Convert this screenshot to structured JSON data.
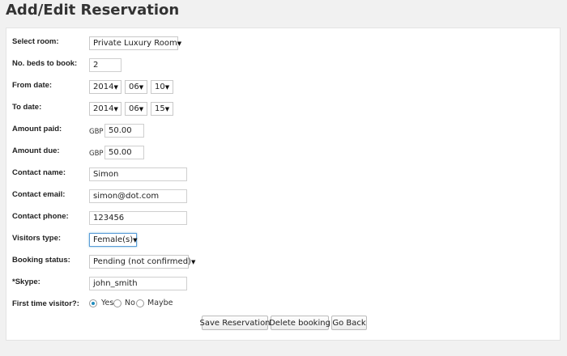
{
  "page": {
    "title": "Add/Edit Reservation"
  },
  "form": {
    "room": {
      "label": "Select room:",
      "value": "Private Luxury Room"
    },
    "beds": {
      "label": "No. beds to book:",
      "value": "2"
    },
    "from_date": {
      "label": "From date:",
      "year": "2014",
      "month": "06",
      "day": "10"
    },
    "to_date": {
      "label": "To date:",
      "year": "2014",
      "month": "06",
      "day": "15"
    },
    "amount_paid": {
      "label": "Amount paid:",
      "currency": "GBP",
      "value": "50.00"
    },
    "amount_due": {
      "label": "Amount due:",
      "currency": "GBP",
      "value": "50.00"
    },
    "contact_name": {
      "label": "Contact name:",
      "value": "Simon"
    },
    "contact_email": {
      "label": "Contact email:",
      "value": "simon@dot.com"
    },
    "contact_phone": {
      "label": "Contact phone:",
      "value": "123456"
    },
    "visitors_type": {
      "label": "Visitors type:",
      "value": "Female(s)"
    },
    "booking_status": {
      "label": "Booking status:",
      "value": "Pending (not confirmed)"
    },
    "skype": {
      "label": "*Skype:",
      "value": "john_smith"
    },
    "first_time": {
      "label": "First time visitor?:",
      "options": [
        "Yes",
        "No",
        "Maybe"
      ],
      "selected": "Yes"
    }
  },
  "buttons": {
    "save": "Save Reservation",
    "delete": "Delete booking",
    "back": "Go Back"
  },
  "icons": {
    "dropdown": "▼"
  },
  "colors": {
    "accent": "#1e8cbe",
    "focus_border": "#5b9dd9"
  }
}
